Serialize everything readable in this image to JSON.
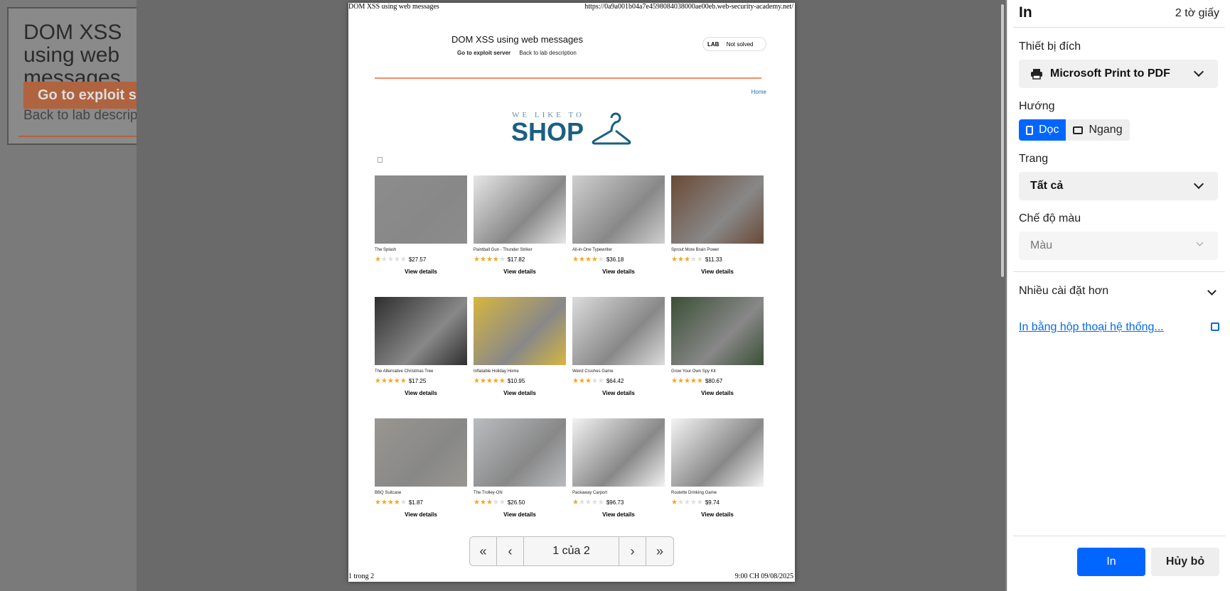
{
  "background_page": {
    "title": "DOM XSS using web messages",
    "exploit_button": "Go to exploit server",
    "back_link": "Back to lab description"
  },
  "sheet": {
    "header_left": "DOM XSS using web messages",
    "header_right": "https://0a9a001b04a7e4598084038000ae00eb.web-security-academy.net/",
    "footer_left": "1 trong 2",
    "footer_right": "9:00 CH 09/08/2025",
    "lab_title": "DOM XSS using web messages",
    "exploit_link": "Go to exploit server",
    "back_link": "Back to lab description",
    "lab_badge": "LAB",
    "lab_status": "Not solved",
    "home_link": "Home",
    "logo_small": "WE LIKE TO",
    "logo_big": "SHOP",
    "view_details": "View details",
    "products": [
      {
        "name": "The Splash",
        "stars": 1,
        "price": "$27.57",
        "color": "#8c8c8c"
      },
      {
        "name": "Paintball Gun - Thunder Striker",
        "stars": 4,
        "price": "$17.82",
        "color": "#e6e6e6"
      },
      {
        "name": "All-in-One Typewriter",
        "stars": 4,
        "price": "$36.18",
        "color": "#cfcfcf"
      },
      {
        "name": "Sprout More Brain Power",
        "stars": 3,
        "price": "$11.33",
        "color": "#6b4a36"
      },
      {
        "name": "The Alternative Christmas Tree",
        "stars": 5,
        "price": "$17.25",
        "color": "#2e2e2e"
      },
      {
        "name": "Inflatable Holiday Home",
        "stars": 5,
        "price": "$10.95",
        "color": "#d6b640"
      },
      {
        "name": "Weird Crushes Game",
        "stars": 3,
        "price": "$64.42",
        "color": "#dcdcdc"
      },
      {
        "name": "Grow Your Own Spy Kit",
        "stars": 5,
        "price": "$80.67",
        "color": "#3b4f36"
      },
      {
        "name": "BBQ Suitcase",
        "stars": 4,
        "price": "$1.87",
        "color": "#9a9690"
      },
      {
        "name": "The Trolley-ON",
        "stars": 3,
        "price": "$26.50",
        "color": "#b9bcc0"
      },
      {
        "name": "Packaway Carport",
        "stars": 1,
        "price": "$96.73",
        "color": "#f2f2f2"
      },
      {
        "name": "Roulette Drinking Game",
        "stars": 1,
        "price": "$9.74",
        "color": "#f4f4f4"
      }
    ]
  },
  "pager": {
    "first": "«",
    "prev": "‹",
    "page": "1 của 2",
    "next": "›",
    "last": "»"
  },
  "panel": {
    "title": "In",
    "sheet_count": "2 tờ giấy",
    "destination_label": "Thiết bị đích",
    "destination_value": "Microsoft Print to PDF",
    "orientation_label": "Hướng",
    "portrait": "Dọc",
    "landscape": "Ngang",
    "pages_label": "Trang",
    "pages_value": "Tất cả",
    "color_label": "Chế độ màu",
    "color_value": "Màu",
    "more_settings": "Nhiều cài đặt hơn",
    "system_dialog": "In bằng hộp thoại hệ thống...",
    "print_button": "In",
    "cancel_button": "Hủy bỏ",
    "accent_color": "#0066ff"
  }
}
